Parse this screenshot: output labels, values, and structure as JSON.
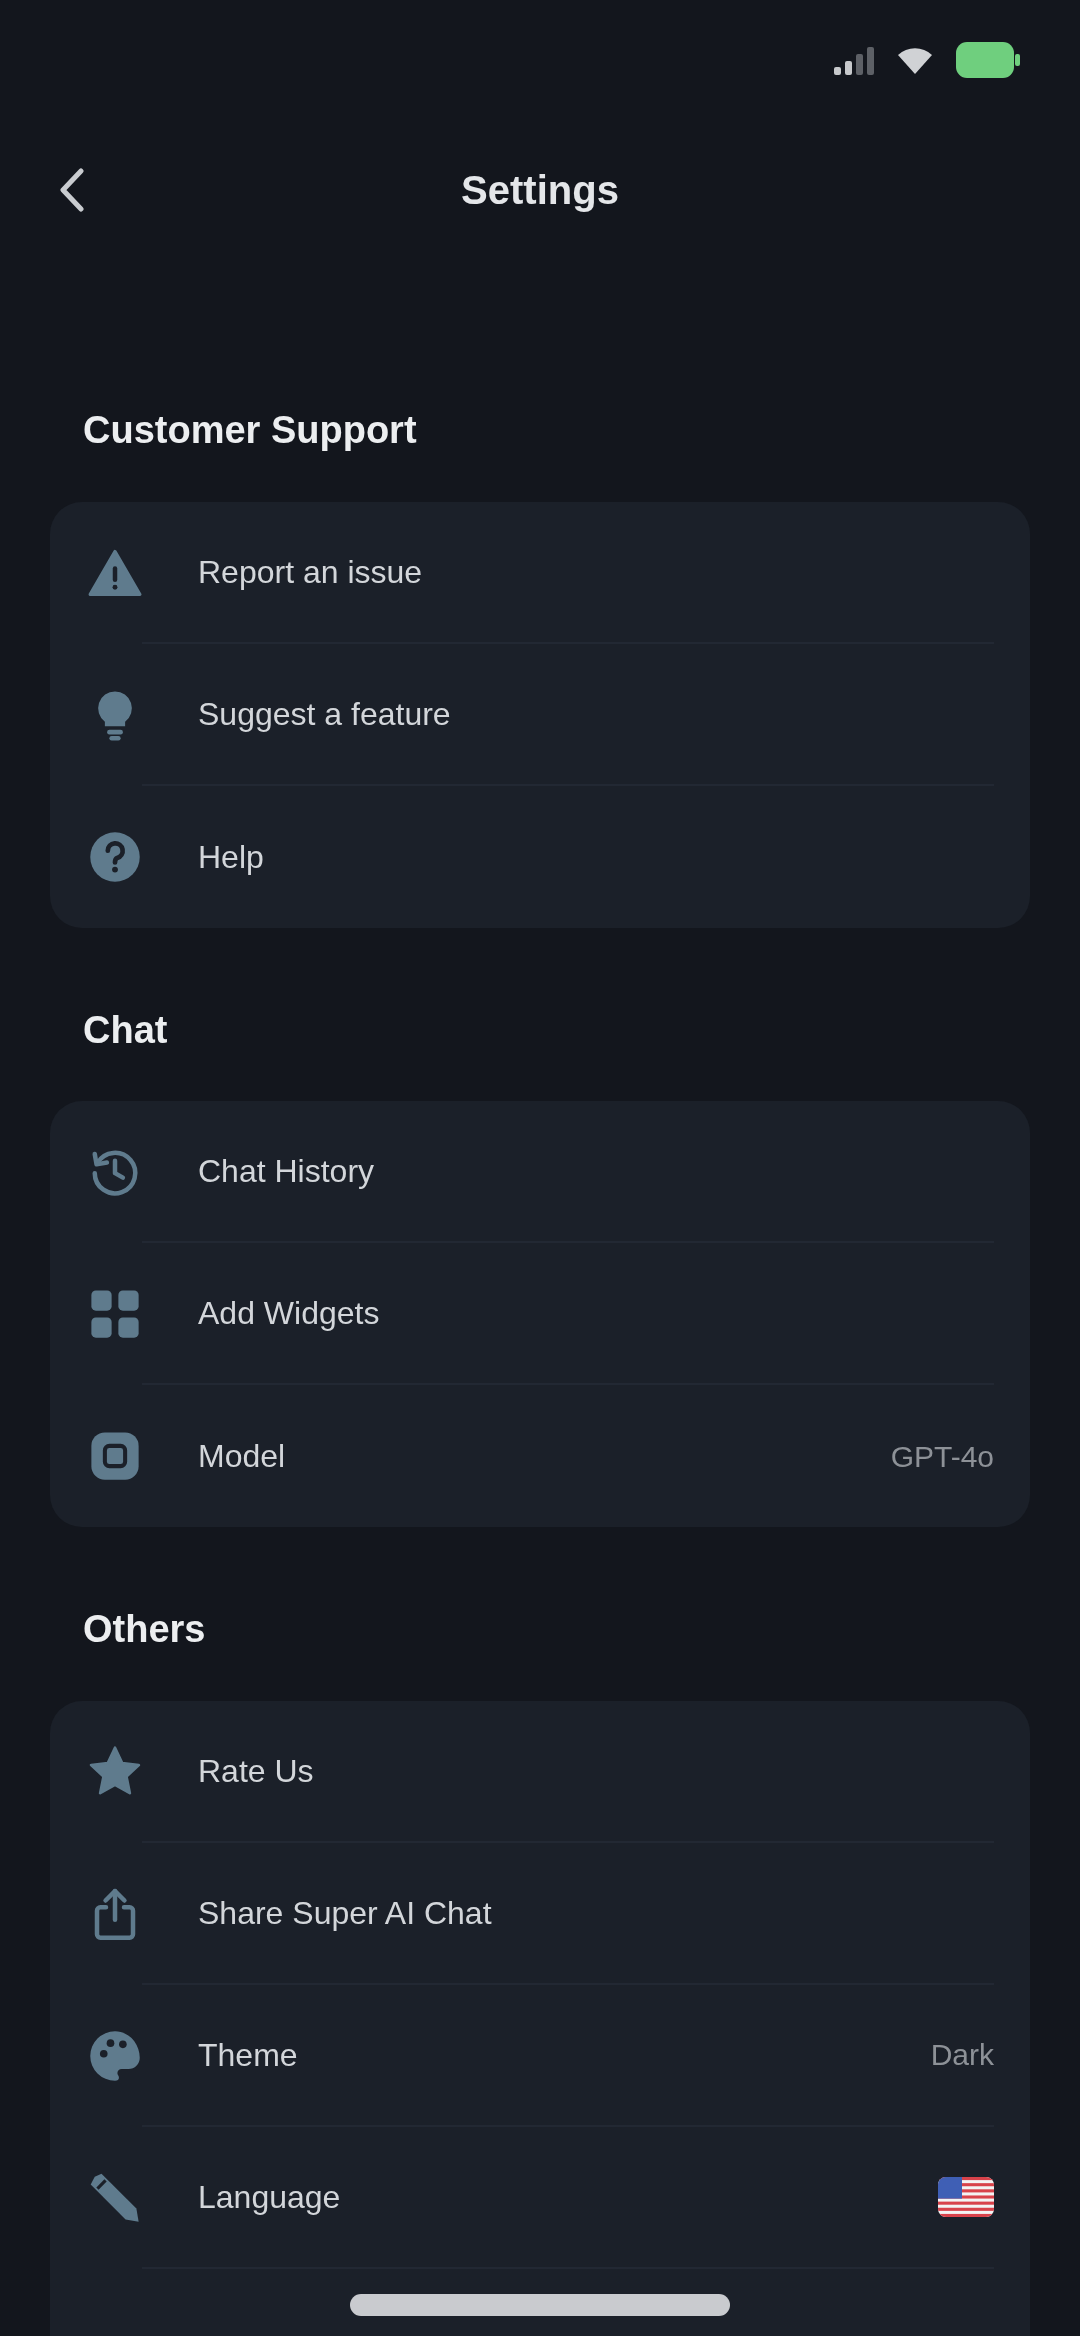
{
  "header": {
    "title": "Settings"
  },
  "sections": [
    {
      "title": "Customer Support",
      "items": [
        {
          "kind": "plain",
          "label": "Report an issue"
        },
        {
          "kind": "plain",
          "label": "Suggest a feature"
        },
        {
          "kind": "plain",
          "label": "Help"
        }
      ]
    },
    {
      "title": "Chat",
      "items": [
        {
          "kind": "plain",
          "label": "Chat History"
        },
        {
          "kind": "plain",
          "label": "Add Widgets"
        },
        {
          "kind": "value",
          "label": "Model",
          "value": "GPT-4o"
        }
      ]
    },
    {
      "title": "Others",
      "items": [
        {
          "kind": "plain",
          "label": "Rate Us"
        },
        {
          "kind": "plain",
          "label": "Share Super AI Chat"
        },
        {
          "kind": "value",
          "label": "Theme",
          "value": "Dark"
        },
        {
          "kind": "flag",
          "label": "Language"
        }
      ]
    }
  ]
}
